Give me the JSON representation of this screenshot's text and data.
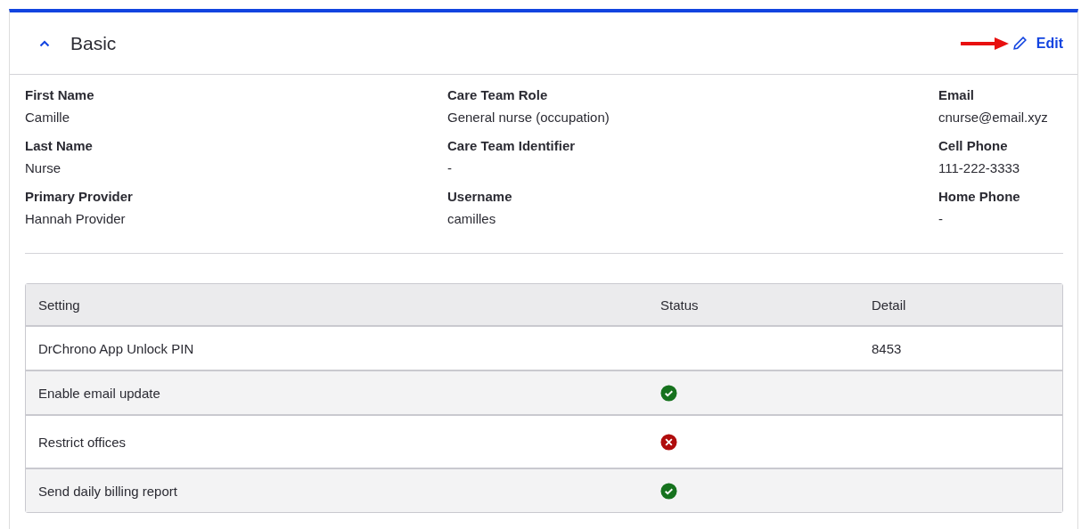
{
  "section": {
    "title": "Basic",
    "expanded": true,
    "edit_label": "Edit"
  },
  "fields": [
    {
      "label": "First Name",
      "value": "Camille"
    },
    {
      "label": "Care Team Role",
      "value": "General nurse (occupation)"
    },
    {
      "label": "Email",
      "value": "cnurse@email.xyz"
    },
    {
      "label": "Last Name",
      "value": "Nurse"
    },
    {
      "label": "Care Team Identifier",
      "value": "-"
    },
    {
      "label": "Cell Phone",
      "value": "111-222-3333"
    },
    {
      "label": "Primary Provider",
      "value": "Hannah Provider"
    },
    {
      "label": "Username",
      "value": "camilles"
    },
    {
      "label": "Home Phone",
      "value": "-"
    }
  ],
  "table": {
    "columns": [
      "Setting",
      "Status",
      "Detail"
    ],
    "rows": [
      {
        "setting": "DrChrono App Unlock PIN",
        "detail": "8453"
      },
      {
        "setting": "Enable email update",
        "enabled": true
      },
      {
        "setting": "Restrict offices",
        "enabled": false
      },
      {
        "setting": "Send daily billing report",
        "enabled": true
      }
    ]
  }
}
